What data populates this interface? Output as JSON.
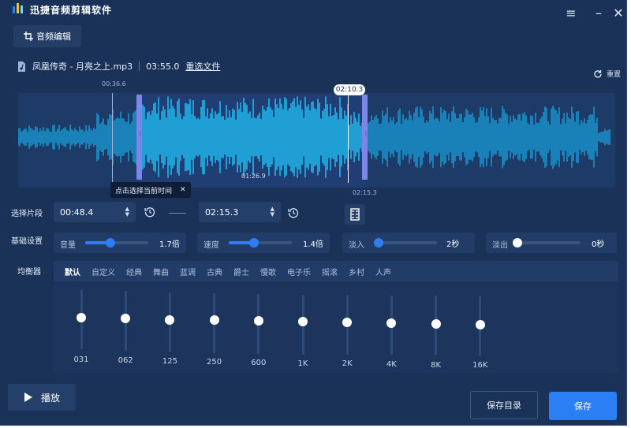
{
  "app": {
    "title": "迅捷音频剪辑软件"
  },
  "toolbar": {
    "audio_edit_label": "音频编辑"
  },
  "file": {
    "name": "凤凰传奇 - 月亮之上.mp3",
    "duration": "03:55.0",
    "reselect_label": "重选文件"
  },
  "reset_label": "重置",
  "waveform": {
    "start_marker": "00:36.6",
    "playhead": "02:10.3",
    "selection_length": "01:26.9",
    "end_marker": "02:15.3",
    "tooltip": "点击选择当前时间"
  },
  "segment": {
    "label": "选择片段",
    "start": "00:48.4",
    "end": "02:15.3"
  },
  "basic": {
    "label": "基础设置",
    "volume": {
      "name": "音量",
      "value": "1.7倍",
      "level": 0.4
    },
    "speed": {
      "name": "速度",
      "value": "1.4倍",
      "level": 0.4
    },
    "fade_in": {
      "name": "淡入",
      "value": "2秒",
      "level": 0.05
    },
    "fade_out": {
      "name": "淡出",
      "value": "0秒",
      "level": 0.0
    }
  },
  "eq": {
    "label": "均衡器",
    "presets": [
      "默认",
      "自定义",
      "经典",
      "舞曲",
      "蓝调",
      "古典",
      "爵士",
      "慢歌",
      "电子乐",
      "摇滚",
      "乡村",
      "人声"
    ],
    "active_preset": "默认",
    "bands": [
      "031",
      "062",
      "125",
      "250",
      "600",
      "1K",
      "2K",
      "4K",
      "8K",
      "16K"
    ]
  },
  "footer": {
    "play_label": "播放",
    "save_dir_label": "保存目录",
    "save_label": "保存"
  },
  "colors": {
    "background": "#1b3258",
    "accent": "#2b7ff5",
    "wave": "#1aa3e0",
    "wave_selected": "#21b8ec",
    "handle": "#7c86e8"
  }
}
